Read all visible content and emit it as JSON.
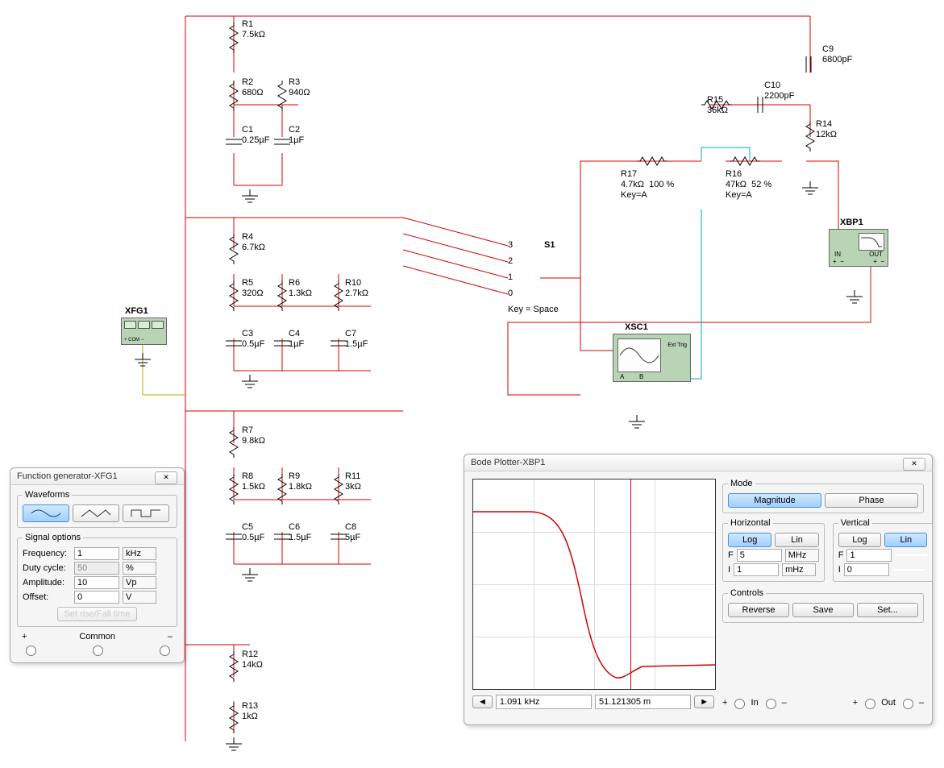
{
  "components": {
    "R1": {
      "name": "R1",
      "value": "7.5kΩ"
    },
    "R2": {
      "name": "R2",
      "value": "680Ω"
    },
    "R3": {
      "name": "R3",
      "value": "940Ω"
    },
    "C1": {
      "name": "C1",
      "value": "0.25µF"
    },
    "C2": {
      "name": "C2",
      "value": "1µF"
    },
    "R4": {
      "name": "R4",
      "value": "6.7kΩ"
    },
    "R5": {
      "name": "R5",
      "value": "320Ω"
    },
    "R6": {
      "name": "R6",
      "value": "1.3kΩ"
    },
    "R10": {
      "name": "R10",
      "value": "2.7kΩ"
    },
    "C3": {
      "name": "C3",
      "value": "0.5µF"
    },
    "C4": {
      "name": "C4",
      "value": "1µF"
    },
    "C7": {
      "name": "C7",
      "value": "1.5µF"
    },
    "R7": {
      "name": "R7",
      "value": "9.8kΩ"
    },
    "R8": {
      "name": "R8",
      "value": "1.5kΩ"
    },
    "R9": {
      "name": "R9",
      "value": "1.8kΩ"
    },
    "R11": {
      "name": "R11",
      "value": "3kΩ"
    },
    "C5": {
      "name": "C5",
      "value": "0.5µF"
    },
    "C6": {
      "name": "C6",
      "value": "1.5µF"
    },
    "C8": {
      "name": "C8",
      "value": "5µF"
    },
    "R12": {
      "name": "R12",
      "value": "14kΩ"
    },
    "R13": {
      "name": "R13",
      "value": "1kΩ"
    },
    "C9": {
      "name": "C9",
      "value": "6800pF"
    },
    "C10": {
      "name": "C10",
      "value": "2200pF"
    },
    "R15": {
      "name": "R15",
      "value": "36kΩ"
    },
    "R14": {
      "name": "R14",
      "value": "12kΩ"
    },
    "R17": {
      "name": "R17",
      "value": "4.7kΩ",
      "pct": "100 %",
      "key": "Key=A"
    },
    "R16": {
      "name": "R16",
      "value": "47kΩ",
      "pct": "52 %",
      "key": "Key=A"
    },
    "S1": {
      "name": "S1",
      "key": "Key = Space",
      "pos": [
        "3",
        "2",
        "1",
        "0"
      ]
    }
  },
  "instruments": {
    "XFG1": "XFG1",
    "XSC1": "XSC1",
    "XBP1": "XBP1",
    "xbp1_labels": {
      "in": "IN",
      "out": "OUT"
    },
    "xsc1_labels": {
      "a": "A",
      "b": "B",
      "ext": "Ext Trig"
    }
  },
  "fgen": {
    "title": "Function generator-XFG1",
    "waveforms": "Waveforms",
    "signal_options": "Signal options",
    "rows": {
      "frequency": {
        "label": "Frequency:",
        "value": "1",
        "unit": "kHz"
      },
      "duty": {
        "label": "Duty cycle:",
        "value": "50",
        "unit": "%"
      },
      "amplitude": {
        "label": "Amplitude:",
        "value": "10",
        "unit": "Vp"
      },
      "offset": {
        "label": "Offset:",
        "value": "0",
        "unit": "V"
      }
    },
    "setrise": "Set rise/Fall time",
    "plus": "+",
    "common": "Common",
    "minus": "–"
  },
  "bode": {
    "title": "Bode Plotter-XBP1",
    "mode": "Mode",
    "magnitude": "Magnitude",
    "phase": "Phase",
    "horizontal": "Horizontal",
    "vertical": "Vertical",
    "log": "Log",
    "lin": "Lin",
    "F": "F",
    "I": "I",
    "hF": "5",
    "hFu": "MHz",
    "hI": "1",
    "hIu": "mHz",
    "vF": "1",
    "vI": "0",
    "controls": "Controls",
    "reverse": "Reverse",
    "save": "Save",
    "set": "Set...",
    "readout_freq": "1.091 kHz",
    "readout_val": "51.121305 m",
    "in": "In",
    "out": "Out",
    "plus": "+",
    "minus": "–"
  }
}
